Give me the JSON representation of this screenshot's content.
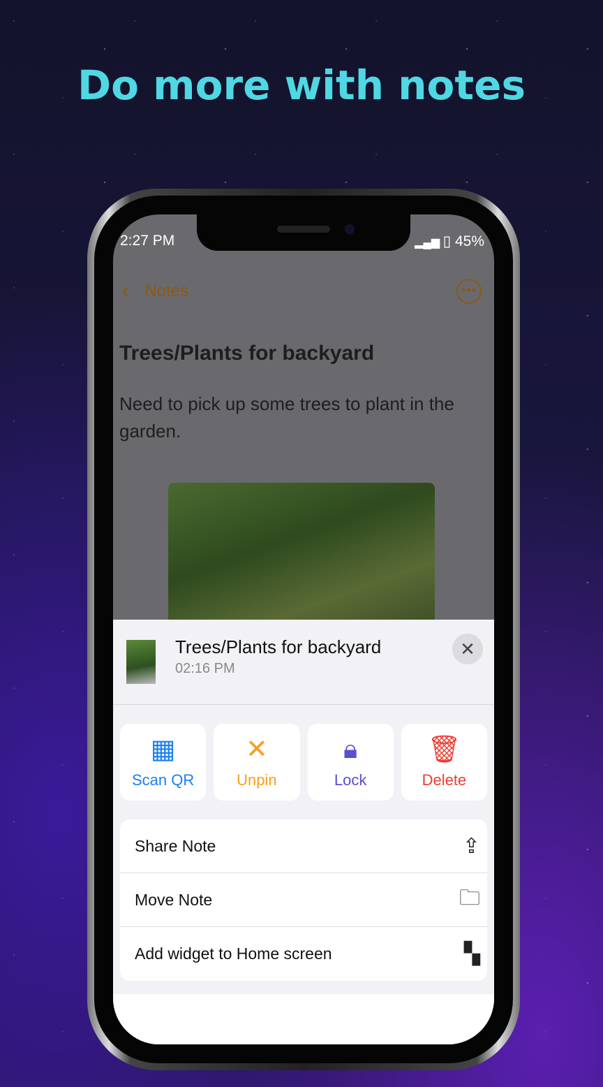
{
  "headline": "Do more with notes",
  "status": {
    "time": "2:27 PM",
    "battery": "45%"
  },
  "nav": {
    "back_label": "Notes",
    "more_icon": "ellipsis-circle-icon"
  },
  "note": {
    "title": "Trees/Plants for backyard",
    "body": "Need to pick up some trees to plant in the garden."
  },
  "sheet": {
    "title": "Trees/Plants for backyard",
    "time": "02:16 PM",
    "actions": [
      {
        "label": "Scan QR",
        "color": "#1a7ff0",
        "icon": "qr-scan-icon"
      },
      {
        "label": "Unpin",
        "color": "#f5a020",
        "icon": "unpin-icon"
      },
      {
        "label": "Lock",
        "color": "#5a4fcf",
        "icon": "lock-icon"
      },
      {
        "label": "Delete",
        "color": "#ee3b30",
        "icon": "trash-icon"
      }
    ],
    "items": [
      {
        "label": "Share Note",
        "icon": "share-icon"
      },
      {
        "label": "Move Note",
        "icon": "folder-icon"
      },
      {
        "label": "Add widget to Home screen",
        "icon": "widget-icon"
      }
    ]
  }
}
